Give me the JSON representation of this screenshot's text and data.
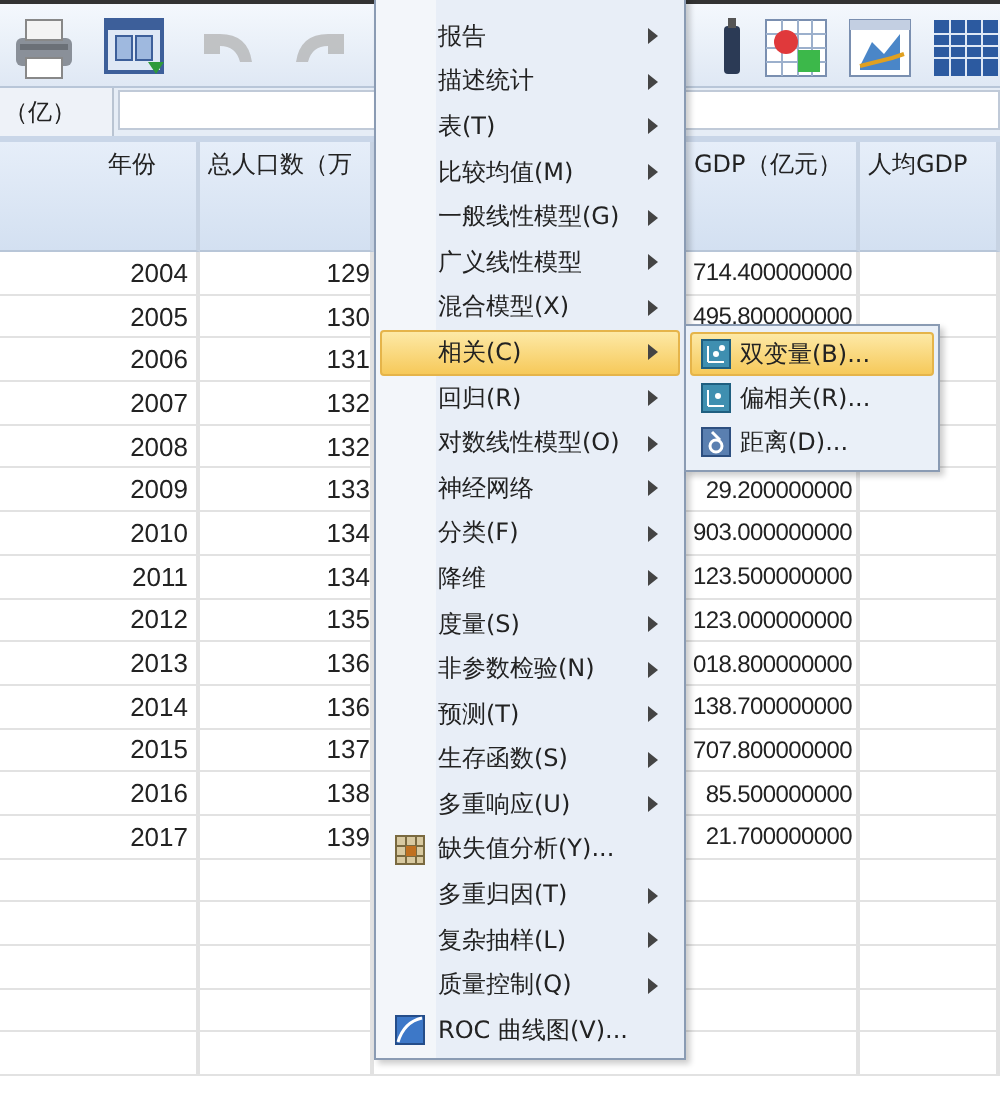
{
  "toolbar": {
    "disabled_buttons": [
      false,
      false,
      true,
      true
    ]
  },
  "cell_ref": {
    "label": "（亿）"
  },
  "table": {
    "columns": [
      "年份",
      "总人口数（万",
      "GDP（亿元）",
      "人均GDP"
    ],
    "rows": [
      {
        "year": "2004",
        "population": "129",
        "gdp": "714.400000000"
      },
      {
        "year": "2005",
        "population": "130",
        "gdp": "495.800000000"
      },
      {
        "year": "2006",
        "population": "131"
      },
      {
        "year": "2007",
        "population": "132"
      },
      {
        "year": "2008",
        "population": "132"
      },
      {
        "year": "2009",
        "population": "133",
        "gdp": "29.200000000"
      },
      {
        "year": "2010",
        "population": "134",
        "gdp": "903.000000000"
      },
      {
        "year": "2011",
        "population": "134",
        "gdp": "123.500000000"
      },
      {
        "year": "2012",
        "population": "135",
        "gdp": "123.000000000"
      },
      {
        "year": "2013",
        "population": "136",
        "gdp": "018.800000000"
      },
      {
        "year": "2014",
        "population": "136",
        "gdp": "138.700000000"
      },
      {
        "year": "2015",
        "population": "137",
        "gdp": "707.800000000"
      },
      {
        "year": "2016",
        "population": "138",
        "gdp": "85.500000000"
      },
      {
        "year": "2017",
        "population": "139",
        "gdp": "21.700000000"
      }
    ]
  },
  "menu": {
    "items": [
      {
        "label": "报告",
        "kind": "submenu",
        "selected": false
      },
      {
        "label": "描述统计",
        "kind": "submenu",
        "selected": false
      },
      {
        "label": "表(T)",
        "kind": "submenu",
        "selected": false
      },
      {
        "label": "比较均值(M)",
        "kind": "submenu",
        "selected": false
      },
      {
        "label": "一般线性模型(G)",
        "kind": "submenu",
        "selected": false
      },
      {
        "label": "广义线性模型",
        "kind": "submenu",
        "selected": false
      },
      {
        "label": "混合模型(X)",
        "kind": "submenu",
        "selected": false
      },
      {
        "label": "相关(C)",
        "kind": "submenu",
        "selected": true
      },
      {
        "label": "回归(R)",
        "kind": "submenu",
        "selected": false
      },
      {
        "label": "对数线性模型(O)",
        "kind": "submenu",
        "selected": false
      },
      {
        "label": "神经网络",
        "kind": "submenu",
        "selected": false
      },
      {
        "label": "分类(F)",
        "kind": "submenu",
        "selected": false
      },
      {
        "label": "降维",
        "kind": "submenu",
        "selected": false
      },
      {
        "label": "度量(S)",
        "kind": "submenu",
        "selected": false
      },
      {
        "label": "非参数检验(N)",
        "kind": "submenu",
        "selected": false
      },
      {
        "label": "预测(T)",
        "kind": "submenu",
        "selected": false
      },
      {
        "label": "生存函数(S)",
        "kind": "submenu",
        "selected": false
      },
      {
        "label": "多重响应(U)",
        "kind": "submenu",
        "selected": false
      },
      {
        "label": "缺失值分析(Y)...",
        "kind": "action",
        "selected": false
      },
      {
        "label": "多重归因(T)",
        "kind": "submenu",
        "selected": false
      },
      {
        "label": "复杂抽样(L)",
        "kind": "submenu",
        "selected": false
      },
      {
        "label": "质量控制(Q)",
        "kind": "submenu",
        "selected": false
      },
      {
        "label": "ROC 曲线图(V)...",
        "kind": "action",
        "selected": false
      }
    ]
  },
  "submenu": {
    "items": [
      {
        "label": "双变量(B)...",
        "selected": true
      },
      {
        "label": "偏相关(R)...",
        "selected": false
      },
      {
        "label": "距离(D)...",
        "selected": false
      }
    ]
  }
}
